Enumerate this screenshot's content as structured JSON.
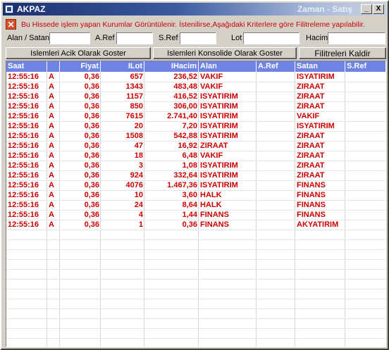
{
  "window": {
    "title": "AKPAZ",
    "subtitle": "Zaman - Satış",
    "minimize_glyph": "_",
    "close_glyph": "X",
    "app_icon": "window-icon"
  },
  "info": {
    "icon": "close-x-icon",
    "icon_glyph": "✕",
    "text": "Bu Hissede işlem yapan Kurumlar Görüntülenir. İstenilirse,Aşağıdaki Kriterlere göre Filitreleme yapılabilir."
  },
  "filters": {
    "alan_satan_label": "Alan / Satan",
    "aref_label": "A.Ref",
    "sref_label": "S.Ref",
    "lot_label": "Lot",
    "hacim_label": "Hacim",
    "alan_satan_value": "",
    "aref_value": "",
    "sref_value": "",
    "lot_value": "",
    "hacim_value": ""
  },
  "buttons": {
    "open_label": "Islemleri Acik Olarak Goster",
    "consolidated_label": "Islemleri Konsolide Olarak Goster",
    "clear_label": "Filitreleri Kaldir"
  },
  "colors": {
    "header_bg": "#6f83e5",
    "row_text": "#cc0000",
    "info_text": "#cc0000"
  },
  "table": {
    "headers": [
      "Saat",
      "",
      "Fiyat",
      "ILot",
      "IHacim",
      "Alan",
      "A.Ref",
      "Satan",
      "S.Ref"
    ],
    "rows": [
      [
        "12:55:16",
        "A",
        "0,36",
        "657",
        "236,52",
        "VAKIF",
        "",
        "ISYATIRIM",
        ""
      ],
      [
        "12:55:16",
        "A",
        "0,36",
        "1343",
        "483,48",
        "VAKIF",
        "",
        "ZIRAAT",
        ""
      ],
      [
        "12:55:16",
        "A",
        "0,36",
        "1157",
        "416,52",
        "ISYATIRIM",
        "",
        "ZIRAAT",
        ""
      ],
      [
        "12:55:16",
        "A",
        "0,36",
        "850",
        "306,00",
        "ISYATIRIM",
        "",
        "ZIRAAT",
        ""
      ],
      [
        "12:55:16",
        "A",
        "0,36",
        "7615",
        "2.741,40",
        "ISYATIRIM",
        "",
        "VAKIF",
        ""
      ],
      [
        "12:55:16",
        "A",
        "0,36",
        "20",
        "7,20",
        "ISYATIRIM",
        "",
        "ISYATIRIM",
        ""
      ],
      [
        "12:55:16",
        "A",
        "0,36",
        "1508",
        "542,88",
        "ISYATIRIM",
        "",
        "ZIRAAT",
        ""
      ],
      [
        "12:55:16",
        "A",
        "0,36",
        "47",
        "16,92",
        "ZIRAAT",
        "",
        "ZIRAAT",
        ""
      ],
      [
        "12:55:16",
        "A",
        "0,36",
        "18",
        "6,48",
        "VAKIF",
        "",
        "ZIRAAT",
        ""
      ],
      [
        "12:55:16",
        "A",
        "0,36",
        "3",
        "1,08",
        "ISYATIRIM",
        "",
        "ZIRAAT",
        ""
      ],
      [
        "12:55:16",
        "A",
        "0,36",
        "924",
        "332,64",
        "ISYATIRIM",
        "",
        "ZIRAAT",
        ""
      ],
      [
        "12:55:16",
        "A",
        "0,36",
        "4076",
        "1.467,36",
        "ISYATIRIM",
        "",
        "FINANS",
        ""
      ],
      [
        "12:55:16",
        "A",
        "0,36",
        "10",
        "3,60",
        "HALK",
        "",
        "FINANS",
        ""
      ],
      [
        "12:55:16",
        "A",
        "0,36",
        "24",
        "8,64",
        "HALK",
        "",
        "FINANS",
        ""
      ],
      [
        "12:55:16",
        "A",
        "0,36",
        "4",
        "1,44",
        "FINANS",
        "",
        "FINANS",
        ""
      ],
      [
        "12:55:16",
        "A",
        "0,36",
        "1",
        "0,36",
        "FINANS",
        "",
        "AKYATIRIM",
        ""
      ]
    ]
  }
}
